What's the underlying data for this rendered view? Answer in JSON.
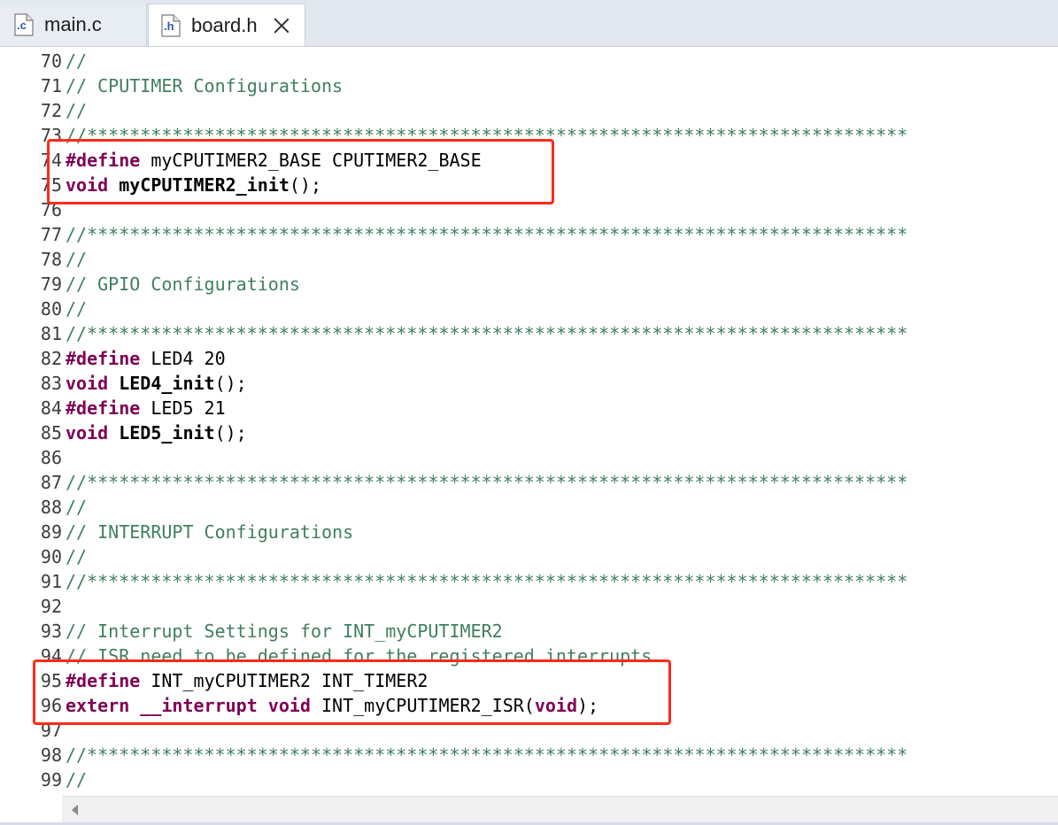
{
  "tabs": [
    {
      "label": "main.c",
      "icon": "c-file-icon",
      "icon_text": ".c",
      "active": false
    },
    {
      "label": "board.h",
      "icon": "h-file-icon",
      "icon_text": ".h",
      "active": true
    }
  ],
  "colors": {
    "comment": "#3f7f5f",
    "keyword": "#7f0055",
    "highlight_box": "#ff2a1a",
    "tab_bar": "#e3e8f0"
  },
  "lines": [
    {
      "n": "70",
      "tokens": [
        {
          "t": "//",
          "c": "cmt"
        }
      ]
    },
    {
      "n": "71",
      "tokens": [
        {
          "t": "// CPUTIMER Configurations",
          "c": "cmt"
        }
      ]
    },
    {
      "n": "72",
      "tokens": [
        {
          "t": "//",
          "c": "cmt"
        }
      ]
    },
    {
      "n": "73",
      "tokens": [
        {
          "t": "//*****************************************************************************",
          "c": "cmt"
        }
      ]
    },
    {
      "n": "74",
      "tokens": [
        {
          "t": "#define",
          "c": "kw"
        },
        {
          "t": " myCPUTIMER2_BASE CPUTIMER2_BASE",
          "c": "txt"
        }
      ]
    },
    {
      "n": "75",
      "tokens": [
        {
          "t": "void",
          "c": "kw"
        },
        {
          "t": " ",
          "c": "txt"
        },
        {
          "t": "myCPUTIMER2_init",
          "c": "fn"
        },
        {
          "t": "();",
          "c": "txt"
        }
      ]
    },
    {
      "n": "76",
      "tokens": []
    },
    {
      "n": "77",
      "tokens": [
        {
          "t": "//*****************************************************************************",
          "c": "cmt"
        }
      ]
    },
    {
      "n": "78",
      "tokens": [
        {
          "t": "//",
          "c": "cmt"
        }
      ]
    },
    {
      "n": "79",
      "tokens": [
        {
          "t": "// GPIO Configurations",
          "c": "cmt"
        }
      ]
    },
    {
      "n": "80",
      "tokens": [
        {
          "t": "//",
          "c": "cmt"
        }
      ]
    },
    {
      "n": "81",
      "tokens": [
        {
          "t": "//*****************************************************************************",
          "c": "cmt"
        }
      ]
    },
    {
      "n": "82",
      "tokens": [
        {
          "t": "#define",
          "c": "kw"
        },
        {
          "t": " LED4 20",
          "c": "txt"
        }
      ]
    },
    {
      "n": "83",
      "tokens": [
        {
          "t": "void",
          "c": "kw"
        },
        {
          "t": " ",
          "c": "txt"
        },
        {
          "t": "LED4_init",
          "c": "fn"
        },
        {
          "t": "();",
          "c": "txt"
        }
      ]
    },
    {
      "n": "84",
      "tokens": [
        {
          "t": "#define",
          "c": "kw"
        },
        {
          "t": " LED5 21",
          "c": "txt"
        }
      ]
    },
    {
      "n": "85",
      "tokens": [
        {
          "t": "void",
          "c": "kw"
        },
        {
          "t": " ",
          "c": "txt"
        },
        {
          "t": "LED5_init",
          "c": "fn"
        },
        {
          "t": "();",
          "c": "txt"
        }
      ]
    },
    {
      "n": "86",
      "tokens": []
    },
    {
      "n": "87",
      "tokens": [
        {
          "t": "//*****************************************************************************",
          "c": "cmt"
        }
      ]
    },
    {
      "n": "88",
      "tokens": [
        {
          "t": "//",
          "c": "cmt"
        }
      ]
    },
    {
      "n": "89",
      "tokens": [
        {
          "t": "// INTERRUPT Configurations",
          "c": "cmt"
        }
      ]
    },
    {
      "n": "90",
      "tokens": [
        {
          "t": "//",
          "c": "cmt"
        }
      ]
    },
    {
      "n": "91",
      "tokens": [
        {
          "t": "//*****************************************************************************",
          "c": "cmt"
        }
      ]
    },
    {
      "n": "92",
      "tokens": []
    },
    {
      "n": "93",
      "tokens": [
        {
          "t": "// Interrupt Settings for INT_myCPUTIMER2",
          "c": "cmt"
        }
      ]
    },
    {
      "n": "94",
      "tokens": [
        {
          "t": "// ISR need to be defined for the registered interrupts",
          "c": "cmt"
        }
      ]
    },
    {
      "n": "95",
      "tokens": [
        {
          "t": "#define",
          "c": "kw"
        },
        {
          "t": " INT_myCPUTIMER2 INT_TIMER2",
          "c": "txt"
        }
      ]
    },
    {
      "n": "96",
      "tokens": [
        {
          "t": "extern",
          "c": "kw"
        },
        {
          "t": " ",
          "c": "txt"
        },
        {
          "t": "__interrupt",
          "c": "kw"
        },
        {
          "t": " ",
          "c": "txt"
        },
        {
          "t": "void",
          "c": "kw"
        },
        {
          "t": " INT_myCPUTIMER2_ISR(",
          "c": "txt"
        },
        {
          "t": "void",
          "c": "kw"
        },
        {
          "t": ");",
          "c": "txt"
        }
      ]
    },
    {
      "n": "97",
      "tokens": []
    },
    {
      "n": "98",
      "tokens": [
        {
          "t": "//*****************************************************************************",
          "c": "cmt"
        }
      ]
    },
    {
      "n": "99",
      "tokens": [
        {
          "t": "//",
          "c": "cmt"
        }
      ]
    }
  ],
  "highlights": [
    {
      "first_line": "74",
      "last_line": "75"
    },
    {
      "first_line": "95",
      "last_line": "96"
    }
  ]
}
